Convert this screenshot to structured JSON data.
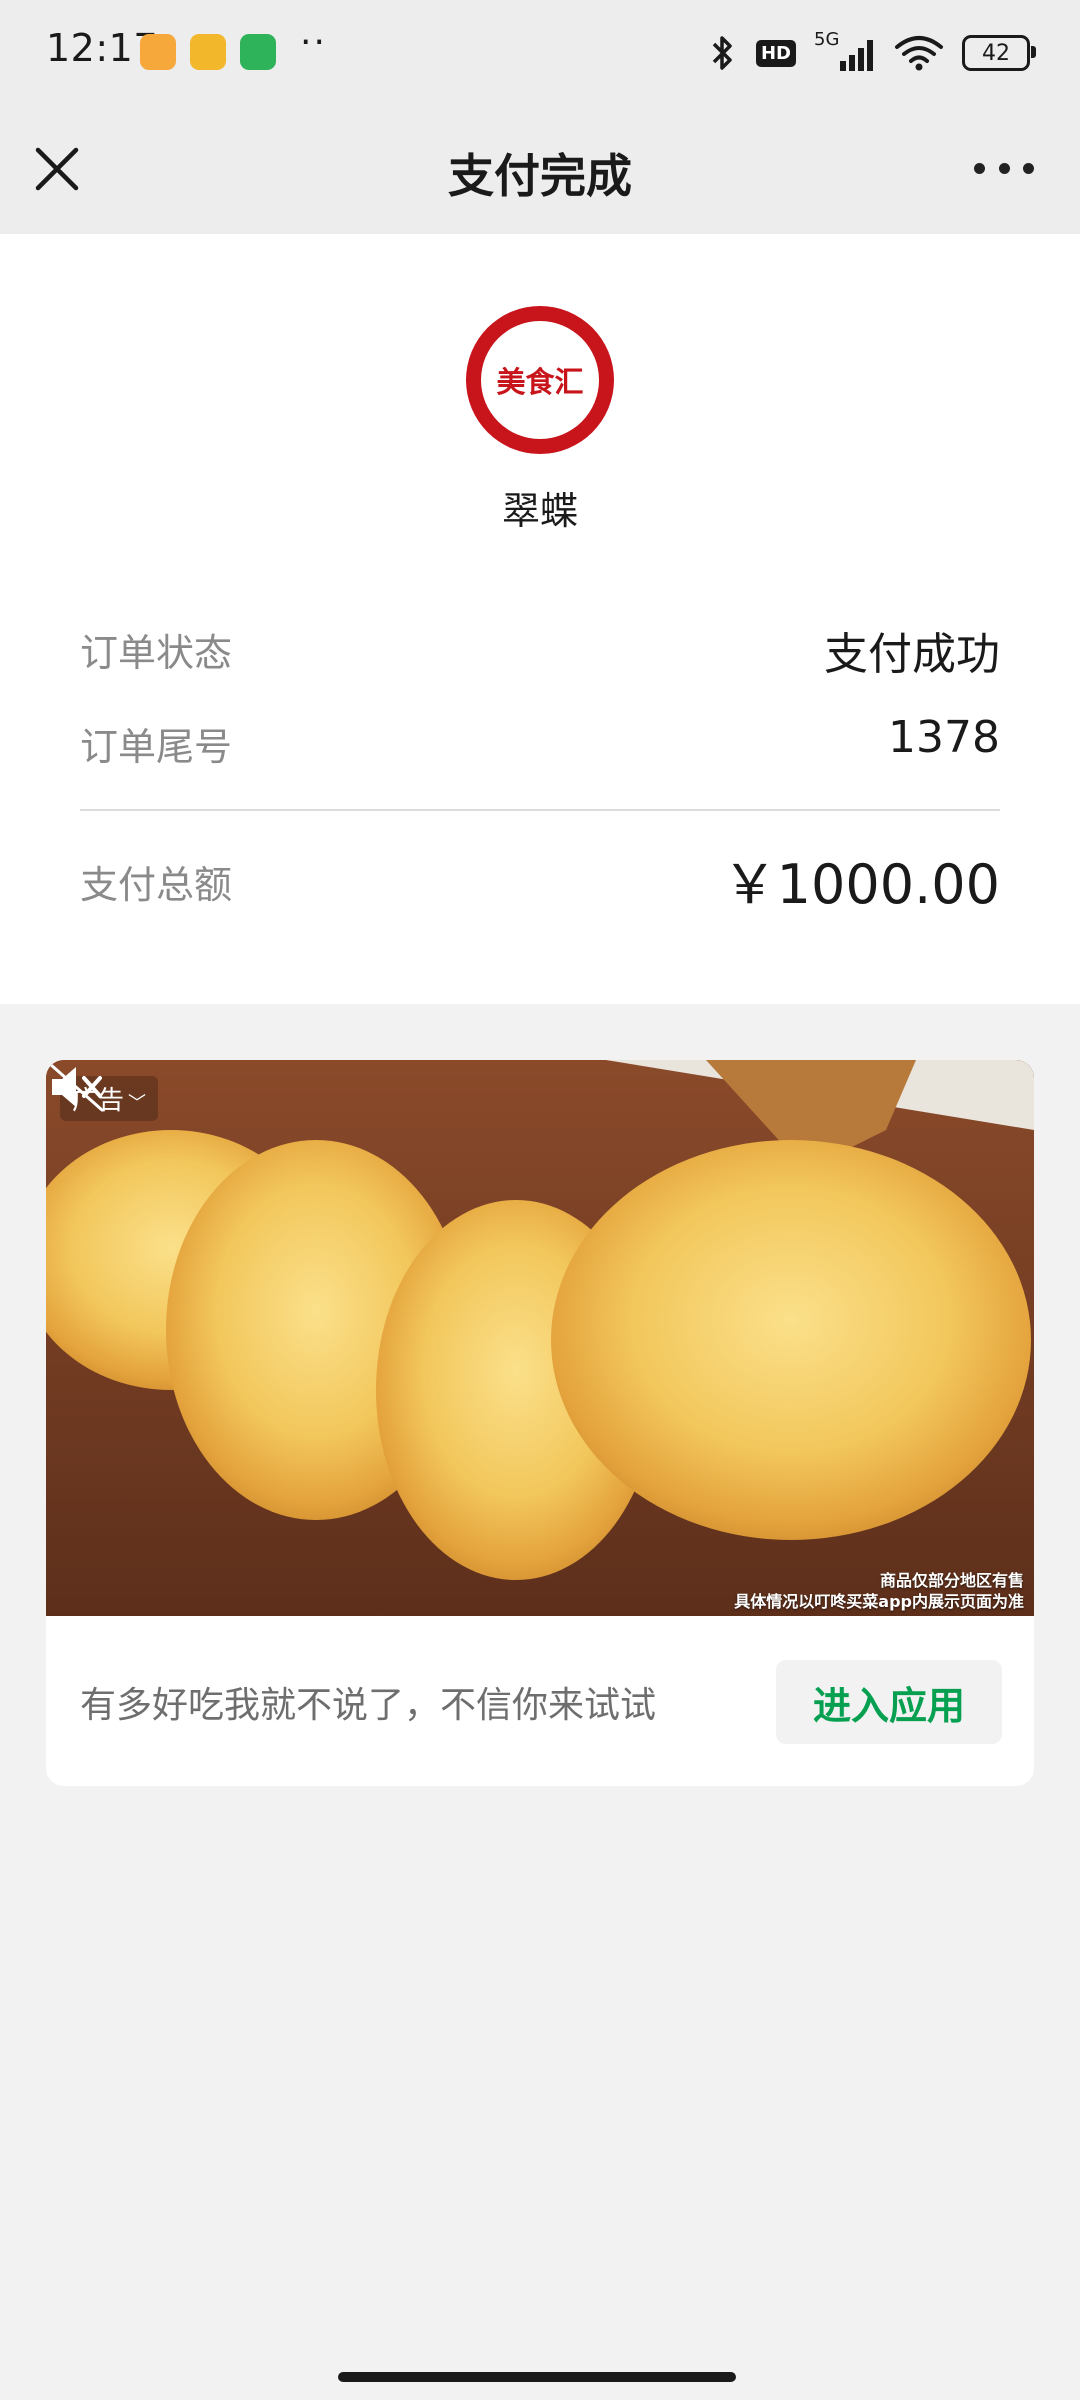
{
  "status_bar": {
    "time": "12:17",
    "dots": "··",
    "hd": "HD",
    "network": "5G",
    "battery": "42",
    "app_icons": [
      {
        "name": "files-app-icon",
        "color": "#f7a83b"
      },
      {
        "name": "mail-app-icon",
        "color": "#f3b72c"
      },
      {
        "name": "phone-app-icon",
        "color": "#2fb35a"
      }
    ]
  },
  "header": {
    "title": "支付完成",
    "close_icon": "close-icon",
    "more_icon": "more-icon"
  },
  "order": {
    "logo_text": "美食汇",
    "merchant": "翠蝶",
    "rows": [
      {
        "label": "订单状态",
        "value": "支付成功"
      },
      {
        "label": "订单尾号",
        "value": "1378"
      }
    ],
    "total_label": "支付总额",
    "total_value": "￥1000.00"
  },
  "ad": {
    "tag": "广告",
    "disclaimer_line1": "商品仅部分地区有售",
    "disclaimer_line2": "具体情况以叮咚买菜app内展示页面为准",
    "text": "有多好吃我就不说了，不信你来试试",
    "button": "进入应用"
  },
  "colors": {
    "accent_green": "#07a051",
    "logo_red": "#c8141b"
  }
}
